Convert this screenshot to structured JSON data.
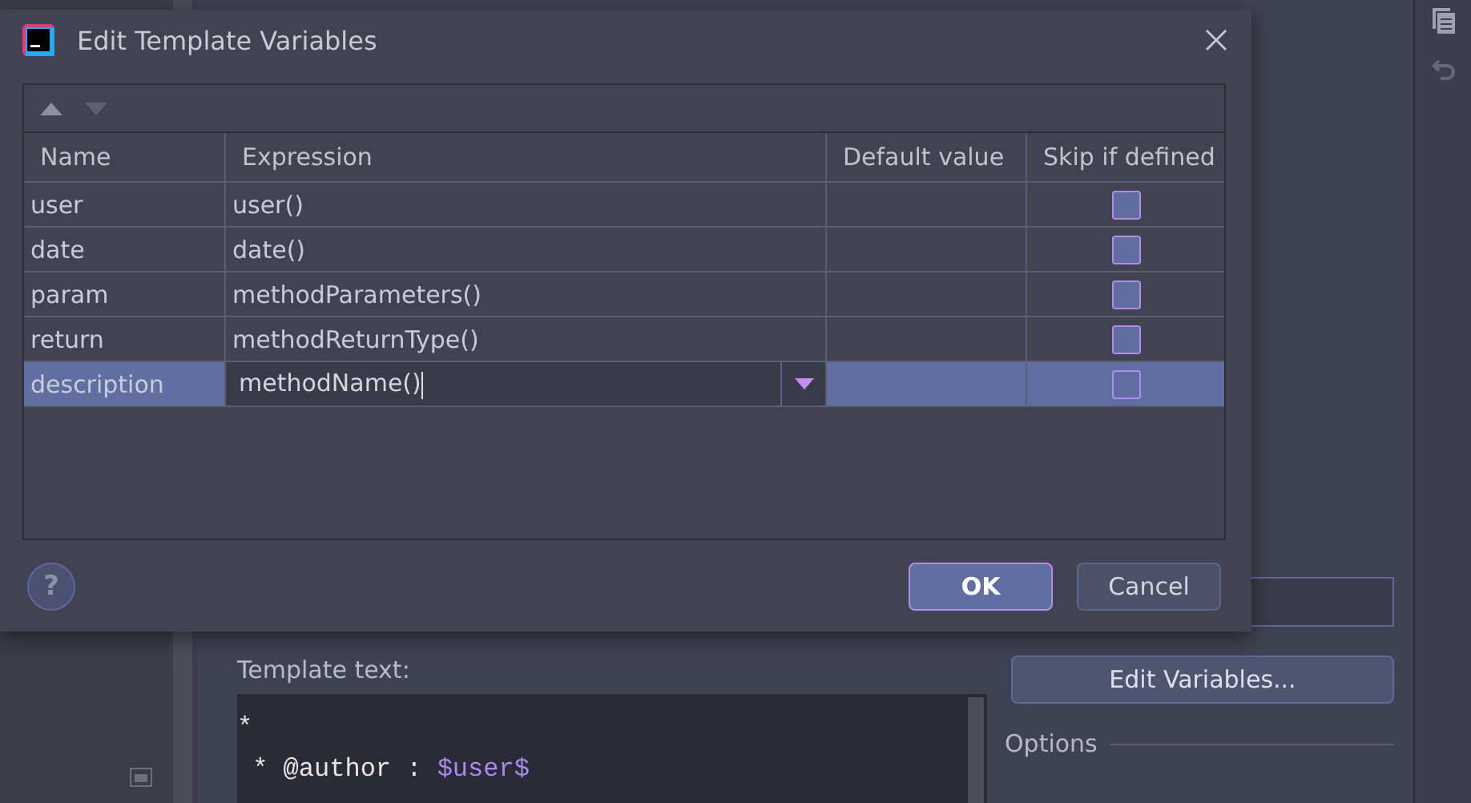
{
  "dialog": {
    "title": "Edit Template Variables",
    "columns": [
      "Name",
      "Expression",
      "Default value",
      "Skip if defined"
    ],
    "rows": [
      {
        "name": "user",
        "expression": "user()",
        "skip_if_defined": false,
        "selected": false
      },
      {
        "name": "date",
        "expression": "date()",
        "skip_if_defined": false,
        "selected": false
      },
      {
        "name": "param",
        "expression": "methodParameters()",
        "skip_if_defined": false,
        "selected": false
      },
      {
        "name": "return",
        "expression": "methodReturnType()",
        "skip_if_defined": false,
        "selected": false
      },
      {
        "name": "description",
        "expression": "methodName()",
        "skip_if_defined": false,
        "selected": true
      }
    ],
    "help": "?",
    "buttons": [
      {
        "label": "OK",
        "default": true
      },
      {
        "label": "Cancel",
        "default": false
      }
    ]
  },
  "background": {
    "template_text_label": "Template text:",
    "template_lines": [
      [
        {
          "text": "*",
          "kind": "plain"
        }
      ],
      [
        {
          "text": " * @author : ",
          "kind": "plain"
        },
        {
          "text": "$user$",
          "kind": "variable"
        }
      ]
    ],
    "edit_variables_button": "Edit Variables...",
    "options_label": "Options"
  }
}
